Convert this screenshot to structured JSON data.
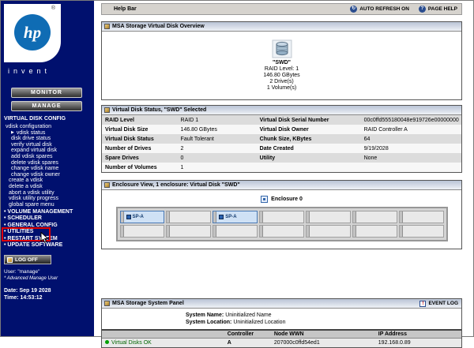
{
  "colors": {
    "sidebar_blue": "#00106e",
    "hp_logo_blue": "#0f6cb4",
    "annotation_red": "#e00000",
    "status_green": "#00a000",
    "selected_bay_blue": "#cfe1f5"
  },
  "icons": {
    "auto_refresh": "↻",
    "page_help": "?",
    "event_log": "!",
    "current_marker": "▶"
  },
  "help_bar": {
    "title": "Help Bar",
    "auto_refresh_label": "AUTO REFRESH ON",
    "page_help_label": "PAGE HELP"
  },
  "sidebar": {
    "logo_text": "hp",
    "logo_reg": "®",
    "logo_tagline": "invent",
    "monitor_button": "MONITOR",
    "manage_button": "MANAGE",
    "section_title": "VIRTUAL DISK CONFIG",
    "menu": [
      "vdisk configuration",
      "vdisk status",
      "disk drive status",
      "verify virtual disk",
      "expand virtual disk",
      "add vdisk spares",
      "delete vdisk spares",
      "change vdisk name",
      "change vdisk owner",
      "create a vdisk",
      "delete a vdisk",
      "abort a vdisk utility",
      "vdisk utility progress",
      "global spare menu"
    ],
    "sections": [
      "VOLUME MANAGEMENT",
      "SCHEDULER",
      "GENERAL CONFIG",
      "UTILITIES",
      "RESTART SYSTEM",
      "UPDATE SOFTWARE"
    ],
    "logoff_button": "LOG OFF",
    "user_line": "User: \"manage\"",
    "user_type_line": "* Advanced Manage User",
    "date_label": "Date:",
    "date_value": "Sep 19 2028",
    "time_label": "Time:",
    "time_value": "14:53:12"
  },
  "overview_panel": {
    "title": "MSA Storage Virtual Disk Overview",
    "disk_name": "\"SWD\"",
    "raid_line": "RAID Level: 1",
    "size_line": "146.80 GBytes",
    "drives_line": "2 Drive(s)",
    "volumes_line": "1 Volume(s)"
  },
  "status_panel": {
    "title": "Virtual Disk Status, \"SWD\" Selected",
    "rows": [
      {
        "l1": "RAID Level",
        "v1": "RAID 1",
        "l2": "Virtual Disk Serial Number",
        "v2": "00c0ffd555180048e919726e00000000"
      },
      {
        "l1": "Virtual Disk Size",
        "v1": "146.80 GBytes",
        "l2": "Virtual Disk Owner",
        "v2": "RAID Controller A"
      },
      {
        "l1": "Virtual Disk Status",
        "v1": "Fault Tolerant",
        "l2": "Chunk Size, KBytes",
        "v2": "64"
      },
      {
        "l1": "Number of Drives",
        "v1": "2",
        "l2": "Date Created",
        "v2": "9/19/2028"
      },
      {
        "l1": "Spare Drives",
        "v1": "0",
        "l2": "Utility",
        "v2": "None"
      },
      {
        "l1": "Number of Volumes",
        "v1": "1",
        "l2": "",
        "v2": ""
      }
    ]
  },
  "enclosure_panel": {
    "title": "Enclosure View, 1 enclosure: Virtual Disk \"SWD\"",
    "enclosure_label": "Enclosure 0",
    "drive_label": "SP-A"
  },
  "system_panel": {
    "title": "MSA Storage System Panel",
    "event_log_label": "EVENT LOG",
    "system_name_label": "System Name:",
    "system_name": "Uninitialized Name",
    "system_location_label": "System Location:",
    "system_location": "Uninitialized Location",
    "table": {
      "headers": [
        "Controller",
        "Node WWN",
        "IP Address"
      ],
      "row": {
        "status": "Virtual Disks OK",
        "controller": "A",
        "wwn": "207000c0ffd54ed1",
        "ip": "192.168.0.89"
      }
    }
  }
}
